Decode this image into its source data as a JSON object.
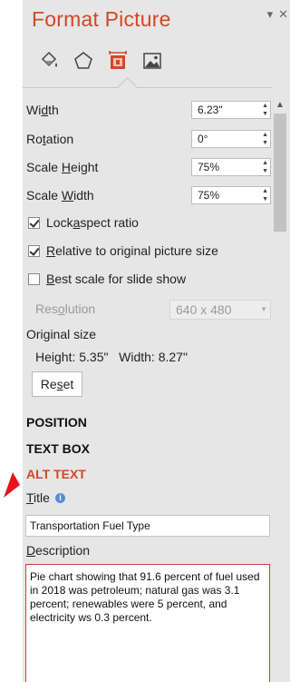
{
  "pane": {
    "title": "Format Picture",
    "controls": {
      "dropdown_icon": "chevron-down-icon",
      "close_icon": "close-icon"
    },
    "tabs": [
      {
        "name": "fill-line-icon"
      },
      {
        "name": "effects-icon"
      },
      {
        "name": "size-properties-icon",
        "active": true
      },
      {
        "name": "picture-icon"
      }
    ],
    "accent_color": "#d24726"
  },
  "size": {
    "width_label_pre": "Wi",
    "width_label_key": "d",
    "width_label_post": "th",
    "width_value": "6.23\"",
    "rotation_label_pre": "Ro",
    "rotation_label_key": "t",
    "rotation_label_post": "ation",
    "rotation_value": "0°",
    "scale_height_label_pre": "Scale ",
    "scale_height_label_key": "H",
    "scale_height_label_post": "eight",
    "scale_height_value": "75%",
    "scale_width_label_pre": "Scale ",
    "scale_width_label_key": "W",
    "scale_width_label_post": "idth",
    "scale_width_value": "75%",
    "lock_aspect_pre": "Lock ",
    "lock_aspect_key": "a",
    "lock_aspect_post": "spect ratio",
    "lock_aspect_checked": true,
    "relative_pre": "",
    "relative_key": "R",
    "relative_post": "elative to original picture size",
    "relative_checked": true,
    "best_scale_pre": "",
    "best_scale_key": "B",
    "best_scale_post": "est scale for slide show",
    "best_scale_checked": false,
    "resolution_label_pre": "Res",
    "resolution_label_key": "o",
    "resolution_label_post": "lution",
    "resolution_value": "640 x 480",
    "original_size_label": "Original size",
    "original_height": "Height:  5.35\"",
    "original_width": "Width:  8.27\"",
    "reset_pre": "Re",
    "reset_key": "s",
    "reset_post": "et"
  },
  "sections": {
    "position": "POSITION",
    "text_box": "TEXT BOX",
    "alt_text": "ALT TEXT"
  },
  "alt_text": {
    "title_label_key": "T",
    "title_label_post": "itle",
    "title_value": "Transportation Fuel Type",
    "description_label_key": "D",
    "description_label_post": "escription",
    "description_value": "Pie chart showing that 91.6 percent of fuel used in 2018 was petroleum; natural gas was 3.1 percent; renewables were 5 percent, and electricity ws 0.3 percent."
  }
}
